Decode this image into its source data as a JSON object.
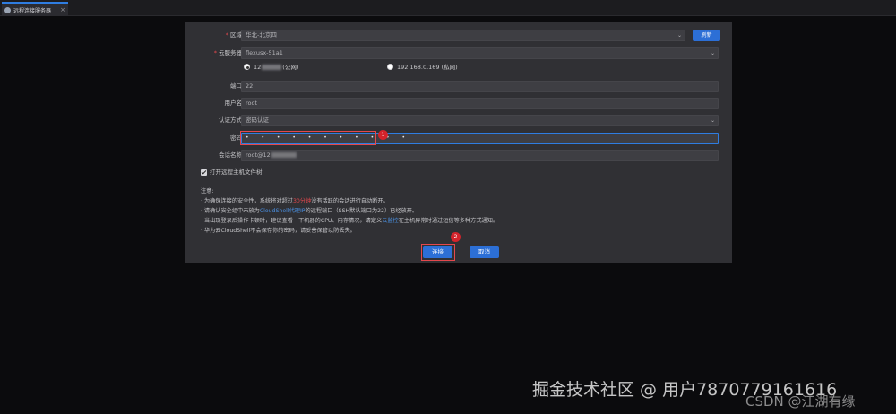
{
  "tab": {
    "label": "远程连接服务器",
    "close": "×"
  },
  "form": {
    "region": {
      "label": "区域",
      "value": "华北-北京四",
      "refresh": "刷新"
    },
    "server": {
      "label": "云服务器",
      "value": "flexusx-51a1"
    },
    "ip_public": {
      "prefix": "12",
      "suffix": "(公网)"
    },
    "ip_private": {
      "value": "192.168.0.169",
      "suffix": "(私网)"
    },
    "port": {
      "label": "端口",
      "value": "22"
    },
    "username": {
      "label": "用户名",
      "value": "root"
    },
    "auth": {
      "label": "认证方式",
      "value": "密码认证"
    },
    "password": {
      "label": "密码",
      "value": "• • • • • • • • • • •"
    },
    "session": {
      "label": "会话名称",
      "prefix": "root@12"
    },
    "open_fs": "打开远程主机文件树"
  },
  "notes": {
    "title": "注意:",
    "line1a": "· 为确保连接的安全性，系统将对超过",
    "line1b": "30分钟",
    "line1c": "没有活跃的会话进行自动断开。",
    "line2a": "· 请确认安全组中未放为",
    "line2b": "CloudShell代理IP",
    "line2c": "的远程端口（SSH默认端口为22）已经放开。",
    "line3a": "· 当出现登录后操作卡顿时，建议查看一下机器的CPU、内存情况，请定义",
    "line3b": "云监控",
    "line3c": "在主机异常时通过短信等多种方式通知。",
    "line4": "· 华为云CloudShell不会保存你的密码，请妥善保管以防丢失。"
  },
  "buttons": {
    "connect": "连接",
    "cancel": "取消"
  },
  "badges": {
    "one": "1",
    "two": "2"
  },
  "watermark": "掘金技术社区 @ 用户7870779161616",
  "csdn": "CSDN @江湖有缘"
}
